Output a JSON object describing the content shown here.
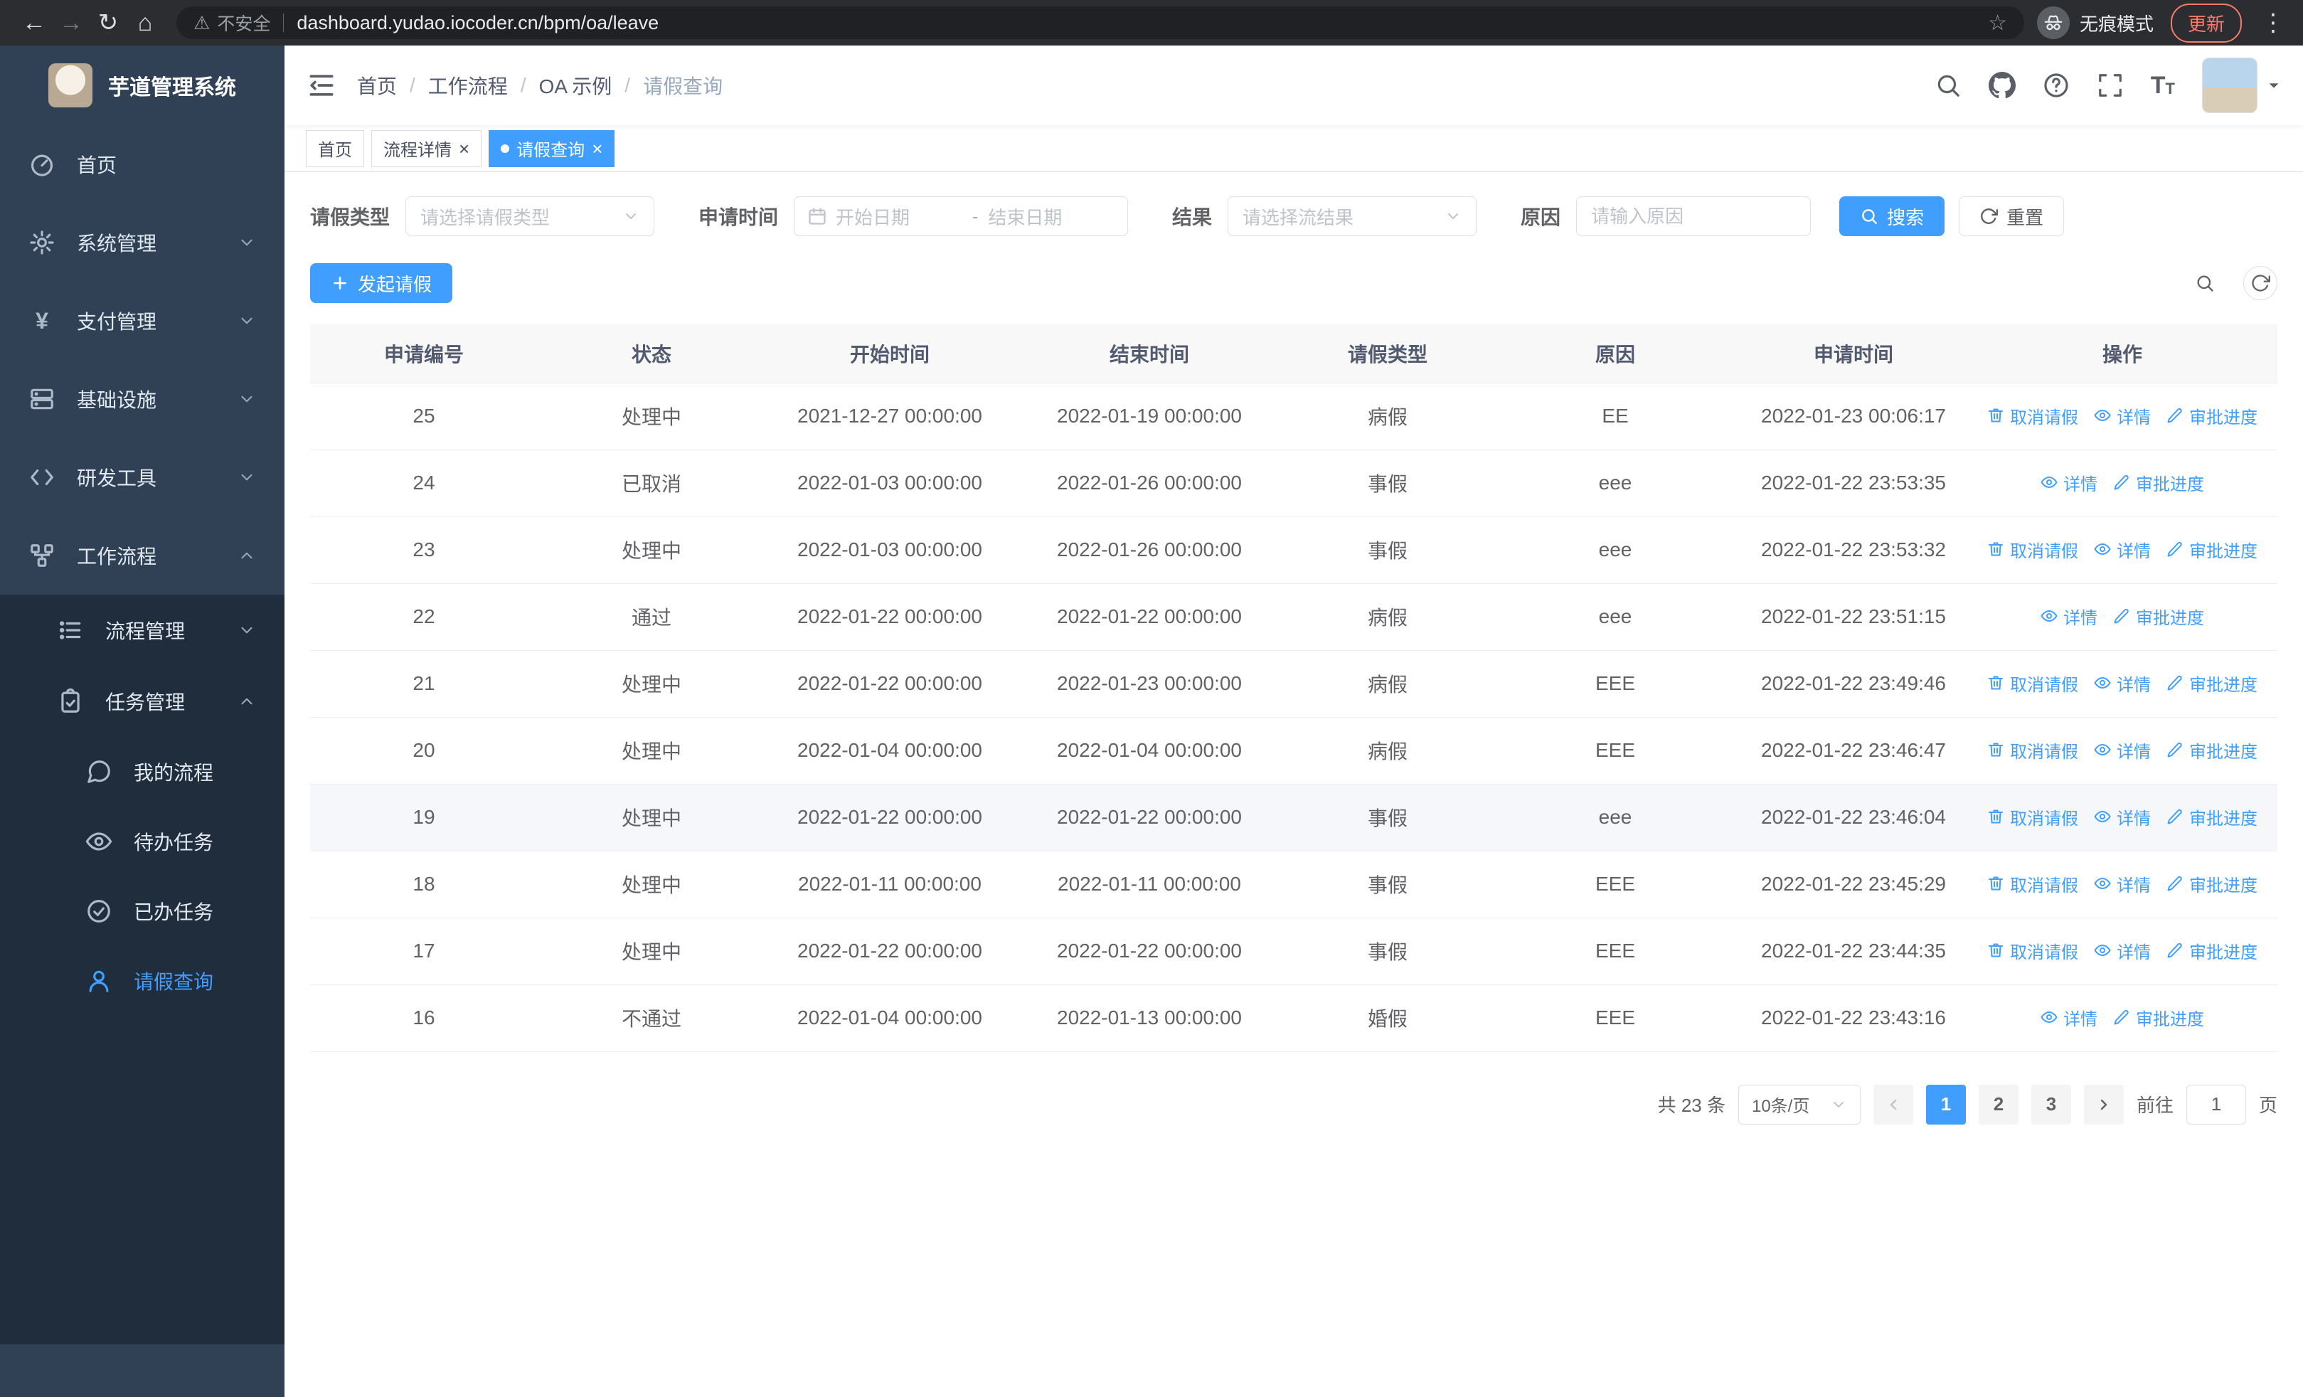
{
  "browser": {
    "security_label": "不安全",
    "url": "dashboard.yudao.iocoder.cn/bpm/oa/leave",
    "incognito_label": "无痕模式",
    "update_label": "更新"
  },
  "sidebar": {
    "app_title": "芋道管理系统",
    "items": [
      {
        "label": "首页"
      },
      {
        "label": "系统管理"
      },
      {
        "label": "支付管理"
      },
      {
        "label": "基础设施"
      },
      {
        "label": "研发工具"
      },
      {
        "label": "工作流程"
      }
    ],
    "workflow_children": [
      {
        "label": "流程管理"
      },
      {
        "label": "任务管理"
      }
    ],
    "task_children": [
      {
        "label": "我的流程"
      },
      {
        "label": "待办任务"
      },
      {
        "label": "已办任务"
      },
      {
        "label": "请假查询"
      }
    ]
  },
  "header": {
    "breadcrumb": [
      "首页",
      "工作流程",
      "OA 示例",
      "请假查询"
    ]
  },
  "tabs": [
    {
      "label": "首页",
      "closable": false,
      "active": false
    },
    {
      "label": "流程详情",
      "closable": true,
      "active": false
    },
    {
      "label": "请假查询",
      "closable": true,
      "active": true
    }
  ],
  "filters": {
    "leave_type_label": "请假类型",
    "leave_type_placeholder": "请选择请假类型",
    "apply_time_label": "申请时间",
    "start_date_placeholder": "开始日期",
    "range_separator": "-",
    "end_date_placeholder": "结束日期",
    "result_label": "结果",
    "result_placeholder": "请选择流结果",
    "reason_label": "原因",
    "reason_placeholder": "请输入原因",
    "search_label": "搜索",
    "reset_label": "重置"
  },
  "toolbar": {
    "create_label": "发起请假"
  },
  "table": {
    "columns": [
      "申请编号",
      "状态",
      "开始时间",
      "结束时间",
      "请假类型",
      "原因",
      "申请时间",
      "操作"
    ],
    "action_labels": {
      "cancel": "取消请假",
      "detail": "详情",
      "progress": "审批进度"
    },
    "rows": [
      {
        "id": "25",
        "status": "处理中",
        "start": "2021-12-27 00:00:00",
        "end": "2022-01-19 00:00:00",
        "type": "病假",
        "reason": "EE",
        "applied": "2022-01-23 00:06:17",
        "actions": [
          "cancel",
          "detail",
          "progress"
        ]
      },
      {
        "id": "24",
        "status": "已取消",
        "start": "2022-01-03 00:00:00",
        "end": "2022-01-26 00:00:00",
        "type": "事假",
        "reason": "eee",
        "applied": "2022-01-22 23:53:35",
        "actions": [
          "detail",
          "progress"
        ]
      },
      {
        "id": "23",
        "status": "处理中",
        "start": "2022-01-03 00:00:00",
        "end": "2022-01-26 00:00:00",
        "type": "事假",
        "reason": "eee",
        "applied": "2022-01-22 23:53:32",
        "actions": [
          "cancel",
          "detail",
          "progress"
        ]
      },
      {
        "id": "22",
        "status": "通过",
        "start": "2022-01-22 00:00:00",
        "end": "2022-01-22 00:00:00",
        "type": "病假",
        "reason": "eee",
        "applied": "2022-01-22 23:51:15",
        "actions": [
          "detail",
          "progress"
        ]
      },
      {
        "id": "21",
        "status": "处理中",
        "start": "2022-01-22 00:00:00",
        "end": "2022-01-23 00:00:00",
        "type": "病假",
        "reason": "EEE",
        "applied": "2022-01-22 23:49:46",
        "actions": [
          "cancel",
          "detail",
          "progress"
        ]
      },
      {
        "id": "20",
        "status": "处理中",
        "start": "2022-01-04 00:00:00",
        "end": "2022-01-04 00:00:00",
        "type": "病假",
        "reason": "EEE",
        "applied": "2022-01-22 23:46:47",
        "actions": [
          "cancel",
          "detail",
          "progress"
        ]
      },
      {
        "id": "19",
        "status": "处理中",
        "start": "2022-01-22 00:00:00",
        "end": "2022-01-22 00:00:00",
        "type": "事假",
        "reason": "eee",
        "applied": "2022-01-22 23:46:04",
        "actions": [
          "cancel",
          "detail",
          "progress"
        ],
        "highlighted": true
      },
      {
        "id": "18",
        "status": "处理中",
        "start": "2022-01-11 00:00:00",
        "end": "2022-01-11 00:00:00",
        "type": "事假",
        "reason": "EEE",
        "applied": "2022-01-22 23:45:29",
        "actions": [
          "cancel",
          "detail",
          "progress"
        ]
      },
      {
        "id": "17",
        "status": "处理中",
        "start": "2022-01-22 00:00:00",
        "end": "2022-01-22 00:00:00",
        "type": "事假",
        "reason": "EEE",
        "applied": "2022-01-22 23:44:35",
        "actions": [
          "cancel",
          "detail",
          "progress"
        ]
      },
      {
        "id": "16",
        "status": "不通过",
        "start": "2022-01-04 00:00:00",
        "end": "2022-01-13 00:00:00",
        "type": "婚假",
        "reason": "EEE",
        "applied": "2022-01-22 23:43:16",
        "actions": [
          "detail",
          "progress"
        ]
      }
    ]
  },
  "pagination": {
    "total_label": "共 23 条",
    "page_size": "10条/页",
    "pages": [
      "1",
      "2",
      "3"
    ],
    "current_page": "1",
    "goto_label": "前往",
    "goto_value": "1",
    "page_unit_label": "页"
  },
  "colors": {
    "primary": "#409eff",
    "sidebar_bg": "#304156",
    "sidebar_sub_bg": "#1f2d3d"
  }
}
